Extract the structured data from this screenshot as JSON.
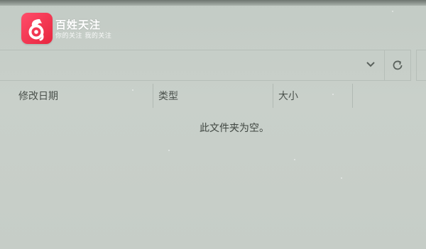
{
  "watermark": {
    "brand_name": "百姓天注",
    "tagline": "你的关注 我的关注"
  },
  "address_bar": {
    "dropdown_icon": "chevron-down-icon",
    "refresh_icon": "refresh-icon"
  },
  "columns": [
    {
      "label": "修改日期"
    },
    {
      "label": "类型"
    },
    {
      "label": "大小"
    }
  ],
  "empty_message": "此文件夹为空。",
  "colors": {
    "background": "#c7cec8",
    "logo_red": "#e8263f",
    "text": "#4a514c"
  }
}
